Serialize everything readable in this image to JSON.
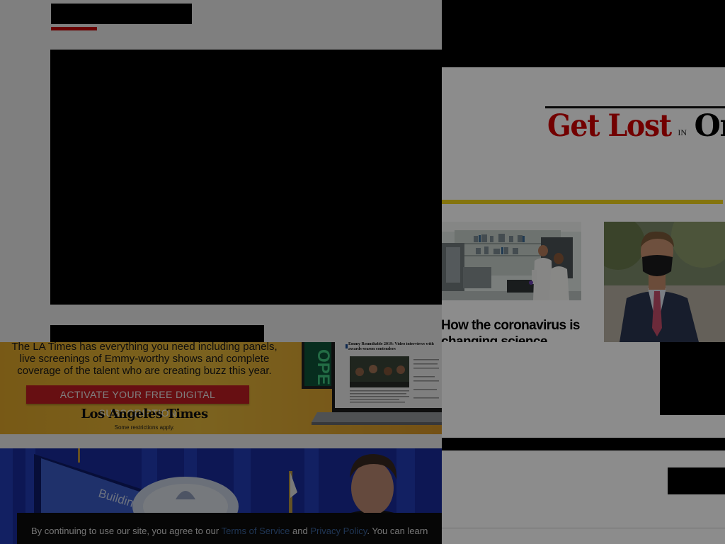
{
  "get_lost_banner": {
    "part1": "Get Lost",
    "part2": "IN",
    "part3": "One"
  },
  "stories": [
    {
      "headline": "How the coronavirus is changing science"
    }
  ],
  "promo": {
    "line1": "The LA Times has everything you need including panels,",
    "line2": "live screenings of Emmy-worthy shows and complete",
    "line3": "coverage of the talent who are creating buzz this year.",
    "cta": "ACTIVATE YOUR FREE DIGITAL SUBSCRIPTION",
    "logo": "Los Angeles Times",
    "fineprint": "Some restrictions apply.",
    "screen_sign": "OPE",
    "screen_title": "Emmy Roundtable 2019: Video interviews with awards-season contenders"
  },
  "governor_photo": {
    "sign_text": "Building a Foun"
  },
  "cookie": {
    "prefix": "By continuing to use our site, you agree to our",
    "terms_link": "Terms of Service",
    "and": "and",
    "privacy_link": "Privacy Policy",
    "suffix": ". You can learn"
  },
  "colors": {
    "brand_red": "#d00000",
    "cta_red": "#cf1f25",
    "accent_yellow": "#f1d41a",
    "promo_orange": "#f2b631",
    "link_blue": "#3f6aa8"
  }
}
